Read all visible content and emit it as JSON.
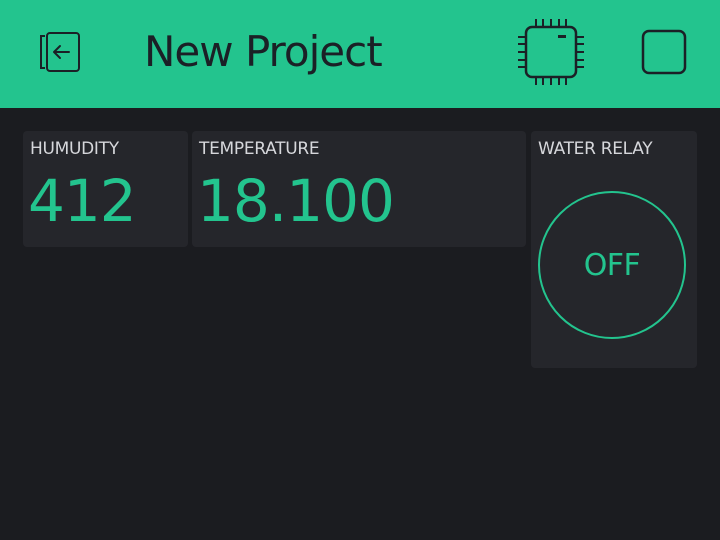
{
  "header": {
    "title": "New Project",
    "back_icon": "exit-icon",
    "device_icon": "chip-icon",
    "stop_icon": "stop-square-icon",
    "bar_color": "#23c48e"
  },
  "widgets": {
    "humidity": {
      "label": "HUMUDITY",
      "value": "412"
    },
    "temperature": {
      "label": "TEMPERATURE",
      "value": "18.100"
    },
    "water_relay": {
      "label": "WATER RELAY",
      "state": "OFF"
    }
  },
  "colors": {
    "accent": "#23c48e",
    "background": "#1b1c20",
    "widget_background": "#25262b",
    "label_text": "#d6d7db"
  }
}
